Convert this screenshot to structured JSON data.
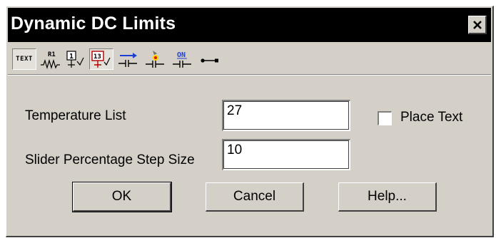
{
  "window": {
    "title": "Dynamic DC Limits",
    "close_glyph": "×"
  },
  "toolbar": {
    "items": [
      {
        "name": "text-mode-icon",
        "label": "TEXT",
        "pressed": true
      },
      {
        "name": "resistor-label-icon",
        "label": "R1",
        "pressed": false
      },
      {
        "name": "node-number-icon",
        "label": "1",
        "pressed": false
      },
      {
        "name": "node-voltage-icon",
        "label": "13",
        "pressed": true
      },
      {
        "name": "current-arrow-icon",
        "pressed": false
      },
      {
        "name": "power-dissipation-icon",
        "pressed": false
      },
      {
        "name": "device-state-icon",
        "label": "ON",
        "pressed": false
      },
      {
        "name": "pin-connection-icon",
        "pressed": false
      }
    ]
  },
  "form": {
    "temperature_label": "Temperature List",
    "temperature_value": "27",
    "step_label": "Slider Percentage Step Size",
    "step_value": "10",
    "place_text_label": "Place Text",
    "place_text_checked": false
  },
  "buttons": {
    "ok": "OK",
    "cancel": "Cancel",
    "help": "Help..."
  }
}
